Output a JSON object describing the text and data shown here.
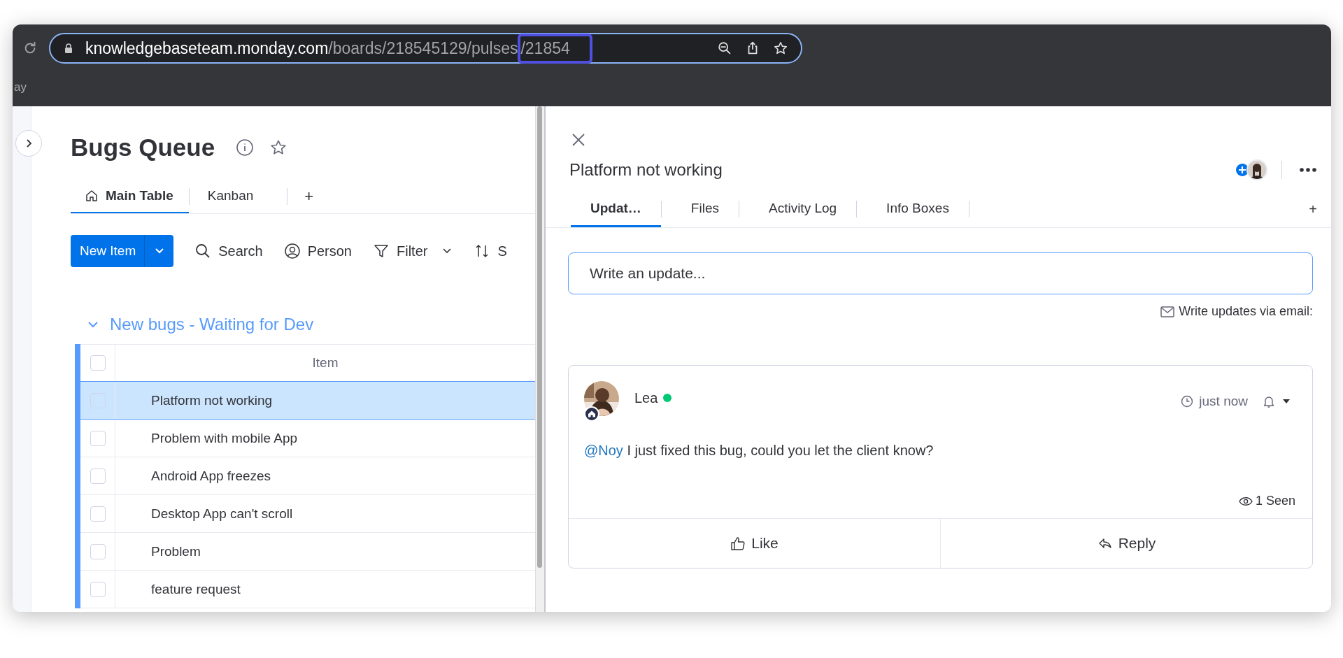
{
  "browser": {
    "address": [
      {
        "text": "knowledgebaseteam.monday.com",
        "kind": "domain"
      },
      {
        "text": "/boards/218545129/pulses",
        "kind": "path"
      },
      {
        "text": "/21854",
        "kind": "highlight"
      }
    ],
    "bookmarks": [
      "ay"
    ]
  },
  "board": {
    "title": "Bugs Queue",
    "tabs": [
      {
        "label": "Main Table",
        "selected": true,
        "kind": "home"
      },
      {
        "label": "Kanban",
        "selected": false,
        "kind": "plain"
      }
    ],
    "add_tab": "+",
    "new_item": "New Item",
    "tools": [
      {
        "label": "Search",
        "kind": "search",
        "dropdown": false
      },
      {
        "label": "Person",
        "kind": "person",
        "dropdown": false
      },
      {
        "label": "Filter",
        "kind": "filter",
        "dropdown": true
      },
      {
        "label": "S",
        "kind": "sort",
        "dropdown": false
      }
    ],
    "group": {
      "title": "New bugs - Waiting for Dev",
      "column": "Item",
      "all_checked": false,
      "rows": [
        {
          "label": "Platform not working",
          "selected": true,
          "checked": false
        },
        {
          "label": "Problem with mobile App",
          "selected": false,
          "checked": false
        },
        {
          "label": "Android App freezes",
          "selected": false,
          "checked": false
        },
        {
          "label": "Desktop App can't scroll",
          "selected": false,
          "checked": false
        },
        {
          "label": "Problem",
          "selected": false,
          "checked": false
        },
        {
          "label": "feature request",
          "selected": false,
          "checked": false
        }
      ]
    }
  },
  "item_panel": {
    "title": "Platform not working",
    "tabs": [
      {
        "label": "Updat…",
        "selected": true
      },
      {
        "label": "Files",
        "selected": false
      },
      {
        "label": "Activity Log",
        "selected": false
      },
      {
        "label": "Info Boxes",
        "selected": false
      }
    ],
    "add_tab": "+",
    "update_field": {
      "placeholder": "Write an update..."
    },
    "email_link": "Write updates via email:",
    "update": {
      "author": "Lea",
      "online": true,
      "time": "just now",
      "mention": "@Noy",
      "text": "I just fixed this bug, could you let the client know?",
      "seen": "1 Seen",
      "actions": [
        {
          "label": "Like",
          "kind": "like"
        },
        {
          "label": "Reply",
          "kind": "reply"
        }
      ]
    }
  }
}
